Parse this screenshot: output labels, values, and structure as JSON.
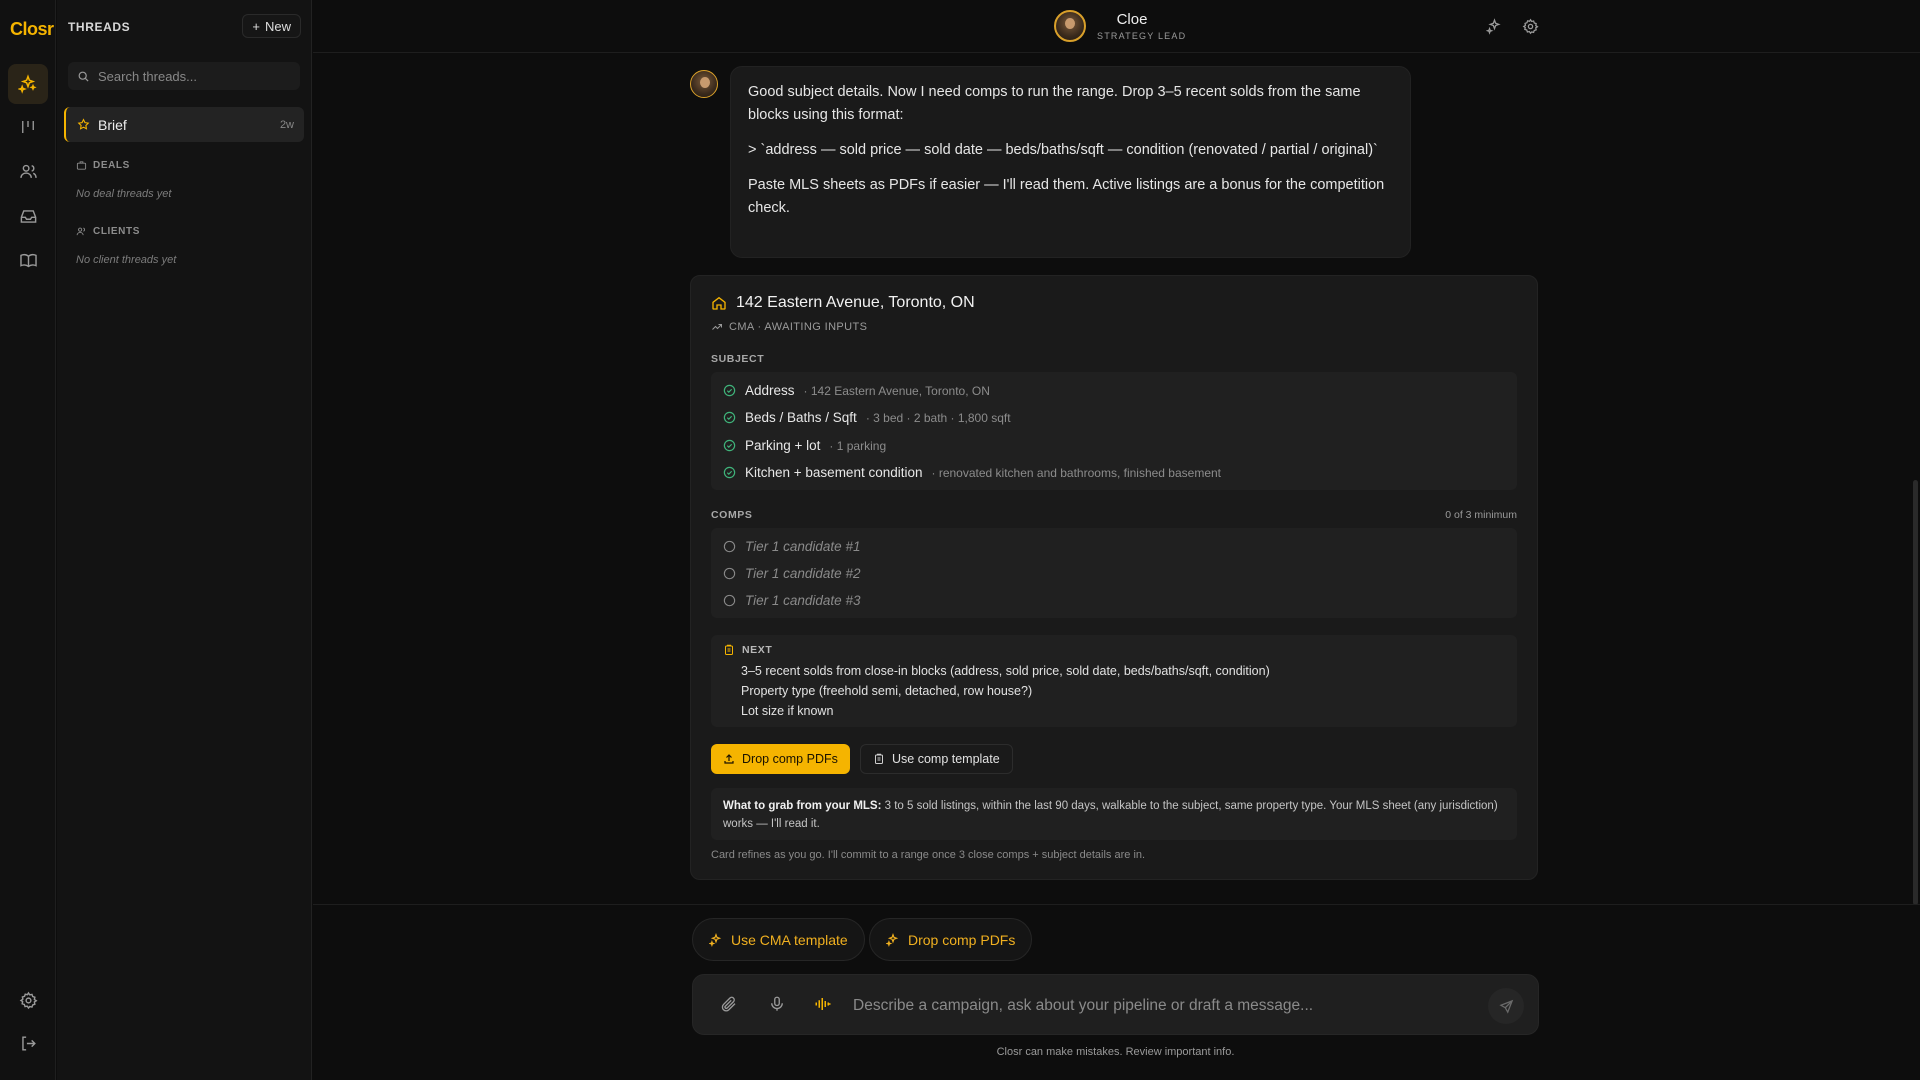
{
  "app": {
    "logo": "Closr"
  },
  "sidebar": {
    "title": "THREADS",
    "new_label": "New",
    "search_placeholder": "Search threads...",
    "active_thread": {
      "label": "Brief",
      "age": "2w"
    },
    "sections": [
      {
        "label": "DEALS",
        "empty": "No deal threads yet"
      },
      {
        "label": "CLIENTS",
        "empty": "No client threads yet"
      }
    ]
  },
  "header": {
    "agent_name": "Cloe",
    "agent_role": "STRATEGY LEAD"
  },
  "message": {
    "line1": "Good subject details. Now I need comps to run the range. Drop 3–5 recent solds from the same blocks using this format:",
    "line2": "> `address — sold price — sold date — beds/baths/sqft — condition (renovated / partial / original)`",
    "line3": "Paste MLS sheets as PDFs if easier — I'll read them. Active listings are a bonus for the competition check."
  },
  "card": {
    "title": "142 Eastern Avenue, Toronto, ON",
    "subtitle": "CMA · AWAITING INPUTS",
    "subject_label": "SUBJECT",
    "subject_rows": [
      {
        "key": "Address",
        "value": "· 142 Eastern Avenue, Toronto, ON"
      },
      {
        "key": "Beds / Baths / Sqft",
        "value": "· 3 bed · 2 bath · 1,800 sqft"
      },
      {
        "key": "Parking + lot",
        "value": "· 1 parking"
      },
      {
        "key": "Kitchen + basement condition",
        "value": "· renovated kitchen and bathrooms, finished basement"
      }
    ],
    "comps_label": "COMPS",
    "comps_count": "0 of 3 minimum",
    "comps": [
      "Tier 1 candidate #1",
      "Tier 1 candidate #2",
      "Tier 1 candidate #3"
    ],
    "next_label": "NEXT",
    "next_items": [
      "3–5 recent solds from close-in blocks (address, sold price, sold date, beds/baths/sqft, condition)",
      "Property type (freehold semi, detached, row house?)",
      "Lot size if known"
    ],
    "primary_button": "Drop comp PDFs",
    "secondary_button": "Use comp template",
    "tip_bold": "What to grab from your MLS:",
    "tip_text": " 3 to 5 sold listings, within the last 90 days, walkable to the subject, same property type. Your MLS sheet (any jurisdiction) works — I'll read it.",
    "footer": "Card refines as you go. I'll commit to a range once 3 close comps + subject details are in."
  },
  "chips": [
    "Use CMA template",
    "Drop comp PDFs"
  ],
  "composer": {
    "placeholder": "Describe a campaign, ask about your pipeline or draft a message..."
  },
  "disclaimer": "Closr can make mistakes. Review important info.",
  "colors": {
    "accent": "#f5b400",
    "check_green": "#3fb37a",
    "background": "#0d0d0d"
  }
}
